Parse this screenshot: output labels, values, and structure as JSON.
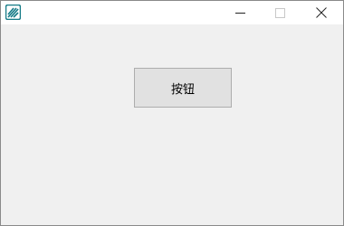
{
  "window": {
    "title_text": "",
    "icon": "app-logo-icon",
    "controls": {
      "minimize_icon": "minimize-icon",
      "maximize_icon": "maximize-icon",
      "close_icon": "close-icon"
    }
  },
  "content": {
    "button_label": "按钮"
  },
  "colors": {
    "titlebar_bg": "#ffffff",
    "client_bg": "#f0f0f0",
    "button_bg": "#e1e1e1",
    "button_border": "#adadad",
    "icon_accent": "#137a86"
  }
}
